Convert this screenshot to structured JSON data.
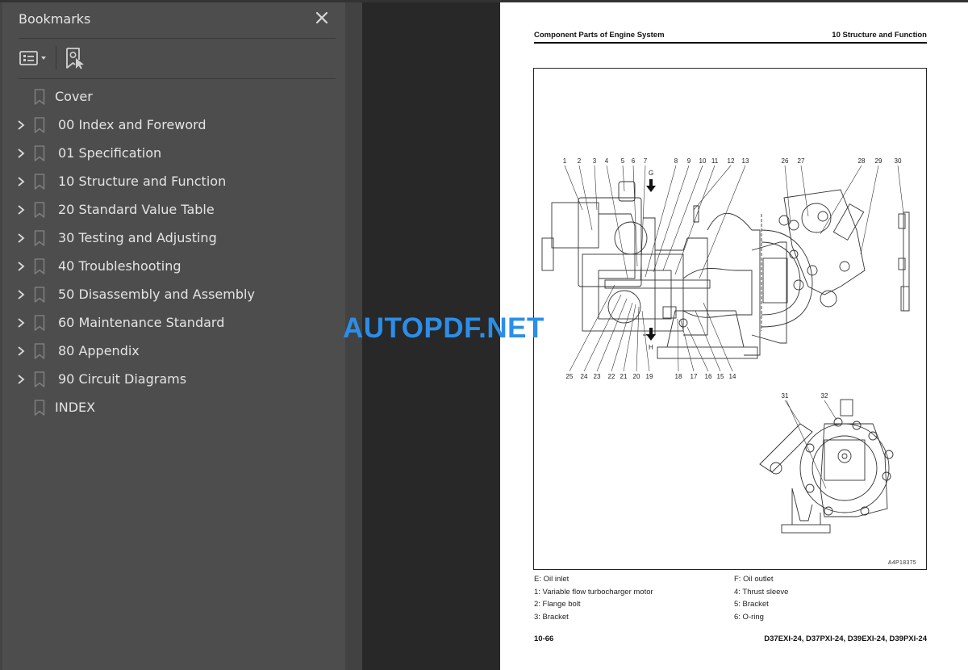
{
  "bookmarks_panel": {
    "title": "Bookmarks",
    "close_icon": "close-icon",
    "toolbar": {
      "options_icon": "list-options-icon",
      "find_bookmark_icon": "find-current-bookmark-icon"
    },
    "items": [
      {
        "label": "Cover",
        "expandable": false
      },
      {
        "label": "00 Index and Foreword",
        "expandable": true
      },
      {
        "label": "01 Specification",
        "expandable": true
      },
      {
        "label": "10 Structure and Function",
        "expandable": true
      },
      {
        "label": "20 Standard Value Table",
        "expandable": true
      },
      {
        "label": "30 Testing and Adjusting",
        "expandable": true
      },
      {
        "label": "40 Troubleshooting",
        "expandable": true
      },
      {
        "label": "50 Disassembly and Assembly",
        "expandable": true
      },
      {
        "label": "60 Maintenance Standard",
        "expandable": true
      },
      {
        "label": "80 Appendix",
        "expandable": true
      },
      {
        "label": "90 Circuit Diagrams",
        "expandable": true
      },
      {
        "label": "INDEX",
        "expandable": false
      }
    ]
  },
  "document": {
    "header_left": "Component Parts of Engine System",
    "header_right": "10 Structure and Function",
    "figure": {
      "code": "A4P18375",
      "direction_labels": [
        "G",
        "H"
      ],
      "callouts_top": [
        "1",
        "2",
        "3",
        "4",
        "5",
        "6",
        "7",
        "8",
        "9",
        "10",
        "11",
        "12",
        "13"
      ],
      "callouts_bottom": [
        "25",
        "24",
        "23",
        "22",
        "21",
        "20",
        "19",
        "18",
        "17",
        "16",
        "15",
        "14"
      ],
      "callouts_right": [
        "26",
        "27",
        "28",
        "29",
        "30"
      ],
      "callouts_lower": [
        "31",
        "32"
      ]
    },
    "legend_col1": [
      "E: Oil inlet",
      "1: Variable flow turbocharger motor",
      "2: Flange bolt",
      "3: Bracket"
    ],
    "legend_col2": [
      "F: Oil outlet",
      "4: Thrust sleeve",
      "5: Bracket",
      "6: O-ring"
    ],
    "footer_left": "10-66",
    "footer_right": "D37EXI-24, D37PXI-24, D39EXI-24, D39PXI-24"
  },
  "watermark": "AUTOPDF.NET",
  "colors": {
    "panel_bg": "#4d4d4d",
    "viewer_bg": "#282828",
    "watermark": "#2b8ee8"
  }
}
